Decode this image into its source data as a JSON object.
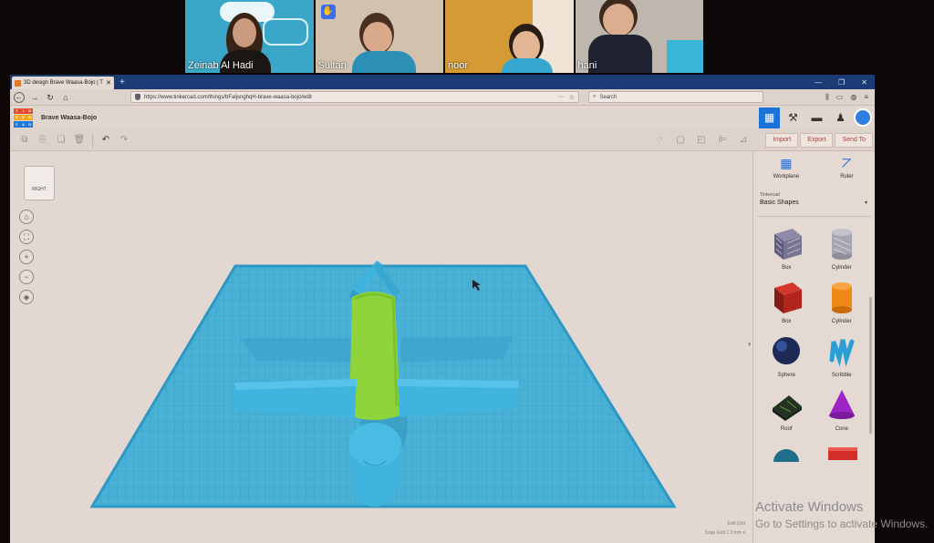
{
  "participants": [
    {
      "name": "Zeinab Al Hadi",
      "bg": "#3aa7c8"
    },
    {
      "name": "Sultan",
      "bg": "#d2c2ad",
      "hand_raised": true
    },
    {
      "name": "noor",
      "bg": "#d59a33"
    },
    {
      "name": "hani",
      "bg": "#bfb7ad"
    }
  ],
  "browser": {
    "tab_title": "3D design Brave Waasa-Bojo | T",
    "close_glyph": "✕",
    "new_tab": "+",
    "win_controls": [
      "—",
      "❐",
      "✕"
    ],
    "url": "https://www.tinkercad.com/things/bFaljsnghqH-brave-waasa-bojo/edit",
    "url_icons": [
      "···",
      "☆"
    ],
    "search_placeholder": "Search",
    "nav_icons": [
      "⫼",
      "▭",
      "◍",
      "≡"
    ]
  },
  "app": {
    "logo_letters": [
      "TIN",
      "KER",
      "CAD"
    ],
    "logo_colors": [
      "#e54d2e",
      "#f3a81b",
      "#1e78d6"
    ],
    "design_title": "Brave Waasa-Bojo",
    "actions": [
      "Import",
      "Export",
      "Send To"
    ]
  },
  "viewcube": {
    "label": "RIGHT"
  },
  "panel": {
    "tools": [
      {
        "label": "Workplane",
        "icon": "workplane-icon"
      },
      {
        "label": "Ruler",
        "icon": "ruler-icon"
      }
    ],
    "category_small": "Tinkercad",
    "category": "Basic Shapes",
    "shapes": [
      {
        "label": "Box",
        "kind": "box-striped"
      },
      {
        "label": "Cylinder",
        "kind": "cylinder-striped"
      },
      {
        "label": "Box",
        "kind": "box-red"
      },
      {
        "label": "Cylinder",
        "kind": "cylinder-orange"
      },
      {
        "label": "Sphere",
        "kind": "sphere"
      },
      {
        "label": "Scribble",
        "kind": "scribble"
      },
      {
        "label": "Roof",
        "kind": "roof"
      },
      {
        "label": "Cone",
        "kind": "cone"
      },
      {
        "label": "",
        "kind": "halfsphere"
      },
      {
        "label": "",
        "kind": "text"
      }
    ]
  },
  "grid": {
    "edit_grid": "Edit Grid",
    "snap_label": "Snap Grid",
    "snap_value": "1.0 mm ▾"
  },
  "watermark": {
    "line1": "Activate Windows",
    "line2": "Go to Settings to activate Windows."
  }
}
